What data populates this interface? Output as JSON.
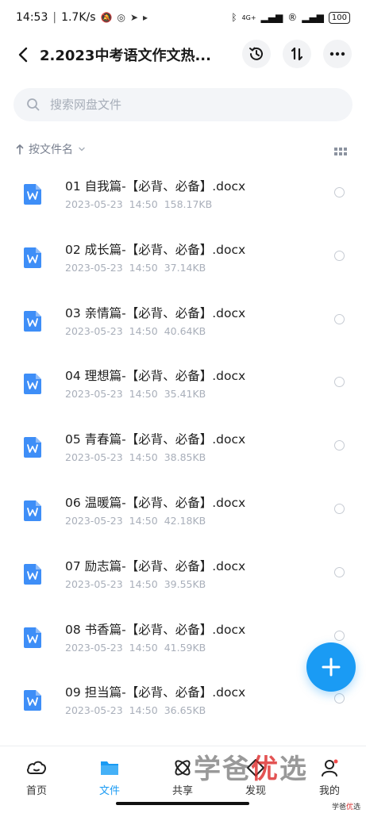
{
  "status_bar": {
    "time": "14:53",
    "network_speed": "1.7K/s",
    "network": "4G+",
    "battery": "100"
  },
  "header": {
    "title": "2.2023中考语文作文热..."
  },
  "search": {
    "placeholder": "搜索网盘文件"
  },
  "sort": {
    "label": "按文件名"
  },
  "files": [
    {
      "name": "01 自我篇-【必背、必备】.docx",
      "date": "2023-05-23",
      "time": "14:50",
      "size": "158.17KB"
    },
    {
      "name": "02 成长篇-【必背、必备】.docx",
      "date": "2023-05-23",
      "time": "14:50",
      "size": "37.14KB"
    },
    {
      "name": "03 亲情篇-【必背、必备】.docx",
      "date": "2023-05-23",
      "time": "14:50",
      "size": "40.64KB"
    },
    {
      "name": "04 理想篇-【必背、必备】.docx",
      "date": "2023-05-23",
      "time": "14:50",
      "size": "35.41KB"
    },
    {
      "name": "05 青春篇-【必背、必备】.docx",
      "date": "2023-05-23",
      "time": "14:50",
      "size": "38.85KB"
    },
    {
      "name": "06 温暖篇-【必背、必备】.docx",
      "date": "2023-05-23",
      "time": "14:50",
      "size": "42.18KB"
    },
    {
      "name": "07 励志篇-【必背、必备】.docx",
      "date": "2023-05-23",
      "time": "14:50",
      "size": "39.55KB"
    },
    {
      "name": "08 书香篇-【必背、必备】.docx",
      "date": "2023-05-23",
      "time": "14:50",
      "size": "41.59KB"
    },
    {
      "name": "09 担当篇-【必背、必备】.docx",
      "date": "2023-05-23",
      "time": "14:50",
      "size": "36.65KB"
    }
  ],
  "nav": {
    "items": [
      {
        "label": "首页"
      },
      {
        "label": "文件"
      },
      {
        "label": "共享"
      },
      {
        "label": "发现"
      },
      {
        "label": "我的"
      }
    ],
    "active_index": 1
  },
  "watermark": {
    "part1": "学爸",
    "part2": "优",
    "part3": "选",
    "small1": "学爸",
    "small2": "优",
    "small3": "选"
  },
  "colors": {
    "accent": "#1a9bf4",
    "file_icon": "#3e8ef7"
  }
}
